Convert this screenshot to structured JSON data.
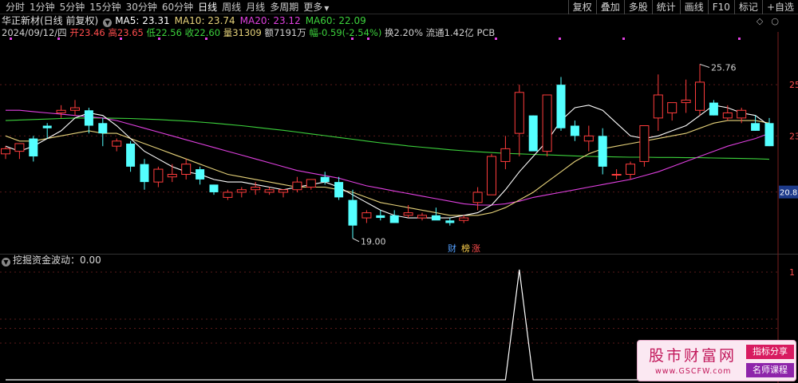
{
  "periods": [
    "分时",
    "1分钟",
    "5分钟",
    "15分钟",
    "30分钟",
    "60分钟",
    "日线",
    "周线",
    "月线",
    "多周期",
    "更多"
  ],
  "active_period": "日线",
  "toolbar": [
    "复权",
    "叠加",
    "多股",
    "统计",
    "画线",
    "F10",
    "标记",
    "+自选"
  ],
  "header": {
    "stock_name": "华正新材(日线 前复权)",
    "ma": [
      {
        "label": "MA5: 23.31",
        "color": "#ffffff"
      },
      {
        "label": "MA10: 23.74",
        "color": "#e6d27a"
      },
      {
        "label": "MA20: 23.12",
        "color": "#e040e0"
      },
      {
        "label": "MA60: 22.09",
        "color": "#3cd23c"
      }
    ]
  },
  "quote": {
    "date": "2024/09/12/四",
    "open_label": "开",
    "open": "23.46",
    "high_label": "高",
    "high": "23.65",
    "low_label": "低",
    "low": "22.56",
    "close_label": "收",
    "close": "22.60",
    "volume_label": "量",
    "volume": "31309",
    "amount_label": "额",
    "amount": "7191万",
    "change_label": "幅",
    "change": "-0.59(-2.54%)",
    "turnover_label": "换",
    "turnover": "2.20%",
    "float_label": "流通",
    "float_cap": "1.42亿",
    "pcb": "PCB"
  },
  "price_axis": [
    "25",
    "23",
    "20.81"
  ],
  "markers": {
    "high": "25.76",
    "low": "19.00"
  },
  "events": {
    "fin": "财",
    "lhb": "榜",
    "zt": "涨"
  },
  "indicator": {
    "title": "挖掘资金波动：0.00",
    "axis": [
      "1"
    ]
  },
  "colors": {
    "up": "#ff3c3c",
    "down": "#54ffff",
    "ma5": "#ffffff",
    "ma10": "#e6d27a",
    "ma20": "#e040e0",
    "ma60": "#3cd23c"
  },
  "watermark": {
    "title": "股市财富网",
    "url": "www.GSCFW.com",
    "tag1": "指标分享",
    "tag2": "名师课程"
  },
  "chart_data": {
    "type": "candlestick",
    "ylim": [
      18.4,
      26.5
    ],
    "candles": [
      [
        22.3,
        22.6,
        22.1,
        22.5
      ],
      [
        22.4,
        22.7,
        22.1,
        22.7
      ],
      [
        22.9,
        23.0,
        22.0,
        22.2
      ],
      [
        23.4,
        23.5,
        22.9,
        23.3
      ],
      [
        23.9,
        24.2,
        23.7,
        24.0
      ],
      [
        24.0,
        24.4,
        23.8,
        24.1
      ],
      [
        24.0,
        24.1,
        23.1,
        23.4
      ],
      [
        23.5,
        23.7,
        22.6,
        23.1
      ],
      [
        22.6,
        22.9,
        22.4,
        22.8
      ],
      [
        22.7,
        22.8,
        21.6,
        21.8
      ],
      [
        21.9,
        22.1,
        20.9,
        21.2
      ],
      [
        21.2,
        21.8,
        21.0,
        21.7
      ],
      [
        21.4,
        21.9,
        21.2,
        21.5
      ],
      [
        21.5,
        22.1,
        21.3,
        21.9
      ],
      [
        21.7,
        21.8,
        21.1,
        21.3
      ],
      [
        21.1,
        21.1,
        20.7,
        20.8
      ],
      [
        20.6,
        20.9,
        20.5,
        20.8
      ],
      [
        20.8,
        21.0,
        20.6,
        20.9
      ],
      [
        20.9,
        21.2,
        20.7,
        21.0
      ],
      [
        20.8,
        21.0,
        20.7,
        20.9
      ],
      [
        20.8,
        20.9,
        20.6,
        20.9
      ],
      [
        20.9,
        21.4,
        20.8,
        21.2
      ],
      [
        21.0,
        21.3,
        20.9,
        21.3
      ],
      [
        21.4,
        21.6,
        21.1,
        21.2
      ],
      [
        21.2,
        21.4,
        20.5,
        20.6
      ],
      [
        20.5,
        20.9,
        19.0,
        19.5
      ],
      [
        19.8,
        20.1,
        19.6,
        20.0
      ],
      [
        19.9,
        20.1,
        19.7,
        19.8
      ],
      [
        19.9,
        20.1,
        19.6,
        19.6
      ],
      [
        19.9,
        20.3,
        19.8,
        20.0
      ],
      [
        19.8,
        20.0,
        19.7,
        19.9
      ],
      [
        19.9,
        20.2,
        19.8,
        19.7
      ],
      [
        19.7,
        19.8,
        19.5,
        19.6
      ],
      [
        19.7,
        19.9,
        19.6,
        19.8
      ],
      [
        20.4,
        21.0,
        20.1,
        20.8
      ],
      [
        20.7,
        22.3,
        20.7,
        22.2
      ],
      [
        22.0,
        23.0,
        21.7,
        22.5
      ],
      [
        23.1,
        25.0,
        22.2,
        24.7
      ],
      [
        23.8,
        23.8,
        23.0,
        22.4
      ],
      [
        22.4,
        24.4,
        22.2,
        24.6
      ],
      [
        25.0,
        25.3,
        23.2,
        23.3
      ],
      [
        23.4,
        23.6,
        22.8,
        23.0
      ],
      [
        22.8,
        23.4,
        22.4,
        23.0
      ],
      [
        23.0,
        23.3,
        21.5,
        21.8
      ],
      [
        21.5,
        21.7,
        21.3,
        21.5
      ],
      [
        21.5,
        22.0,
        21.3,
        21.9
      ],
      [
        22.0,
        22.4,
        21.8,
        23.4
      ],
      [
        23.7,
        25.4,
        23.2,
        24.6
      ],
      [
        23.9,
        24.1,
        23.6,
        24.3
      ],
      [
        24.3,
        25.2,
        23.9,
        24.4
      ],
      [
        24.0,
        25.8,
        23.8,
        25.1
      ],
      [
        24.3,
        24.4,
        23.8,
        23.8
      ],
      [
        23.7,
        24.2,
        23.6,
        23.9
      ],
      [
        23.7,
        24.1,
        23.5,
        24.0
      ],
      [
        23.5,
        23.8,
        23.2,
        23.2
      ],
      [
        23.5,
        23.7,
        22.6,
        22.6
      ]
    ],
    "ma5": [
      22.6,
      22.4,
      22.6,
      22.9,
      23.2,
      23.7,
      23.9,
      23.8,
      23.4,
      22.9,
      22.4,
      22.1,
      21.8,
      21.6,
      21.5,
      21.3,
      21.2,
      21.2,
      21.1,
      21.0,
      20.9,
      21.0,
      21.1,
      21.2,
      21.0,
      20.7,
      20.4,
      20.1,
      19.9,
      19.8,
      19.8,
      19.8,
      19.8,
      19.9,
      20.0,
      20.3,
      20.9,
      21.6,
      22.2,
      22.8,
      23.6,
      24.1,
      24.2,
      24.0,
      23.5,
      23.0,
      22.9,
      23.0,
      23.2,
      23.4,
      23.8,
      24.2,
      24.1,
      23.9,
      23.8,
      23.4
    ],
    "ma10": [
      23.0,
      22.8,
      22.8,
      22.9,
      23.0,
      23.1,
      23.2,
      23.1,
      23.1,
      22.9,
      22.7,
      22.5,
      22.3,
      22.1,
      21.9,
      21.7,
      21.5,
      21.4,
      21.3,
      21.2,
      21.1,
      21.0,
      21.0,
      21.0,
      20.9,
      20.8,
      20.6,
      20.4,
      20.3,
      20.2,
      20.1,
      20.0,
      19.9,
      19.9,
      19.9,
      20.0,
      20.2,
      20.5,
      20.8,
      21.2,
      21.6,
      22.0,
      22.3,
      22.5,
      22.6,
      22.7,
      22.8,
      22.9,
      23.0,
      23.1,
      23.3,
      23.5,
      23.6,
      23.6,
      23.6,
      23.5
    ],
    "ma20": [
      24.0,
      24.0,
      23.95,
      23.9,
      23.85,
      23.8,
      23.75,
      23.7,
      23.6,
      23.45,
      23.3,
      23.15,
      23.0,
      22.85,
      22.7,
      22.55,
      22.4,
      22.25,
      22.1,
      21.95,
      21.8,
      21.65,
      21.55,
      21.45,
      21.35,
      21.2,
      21.05,
      20.95,
      20.85,
      20.75,
      20.65,
      20.55,
      20.45,
      20.35,
      20.3,
      20.3,
      20.35,
      20.45,
      20.6,
      20.7,
      20.8,
      20.9,
      21.0,
      21.1,
      21.2,
      21.3,
      21.45,
      21.6,
      21.8,
      22.0,
      22.2,
      22.4,
      22.6,
      22.75,
      22.9,
      23.1
    ],
    "ma60": [
      23.6,
      23.62,
      23.64,
      23.66,
      23.68,
      23.7,
      23.7,
      23.7,
      23.69,
      23.68,
      23.66,
      23.64,
      23.61,
      23.58,
      23.54,
      23.5,
      23.45,
      23.4,
      23.34,
      23.28,
      23.22,
      23.15,
      23.08,
      23.01,
      22.94,
      22.87,
      22.8,
      22.73,
      22.67,
      22.61,
      22.56,
      22.51,
      22.46,
      22.42,
      22.38,
      22.35,
      22.32,
      22.3,
      22.28,
      22.26,
      22.24,
      22.22,
      22.2,
      22.19,
      22.18,
      22.17,
      22.17,
      22.16,
      22.16,
      22.15,
      22.15,
      22.14,
      22.13,
      22.12,
      22.11,
      22.09
    ],
    "indicator_spike_index": 37,
    "indicator_spike_value": 1
  }
}
